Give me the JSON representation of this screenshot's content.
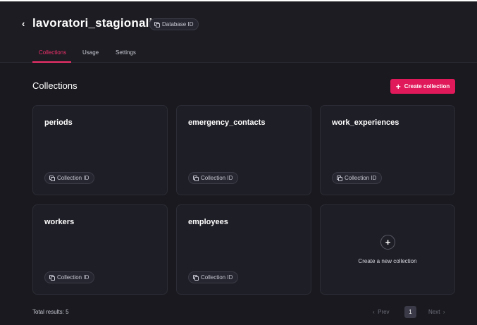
{
  "header": {
    "back_icon": "chevron-left-icon",
    "title": "lavoratori_stagionali",
    "db_id_label": "Database ID"
  },
  "tabs": [
    {
      "label": "Collections",
      "active": true
    },
    {
      "label": "Usage",
      "active": false
    },
    {
      "label": "Settings",
      "active": false
    }
  ],
  "section": {
    "title": "Collections",
    "create_label": "Create collection"
  },
  "collections": [
    {
      "name": "periods",
      "id_label": "Collection ID"
    },
    {
      "name": "emergency_contacts",
      "id_label": "Collection ID"
    },
    {
      "name": "work_experiences",
      "id_label": "Collection ID"
    },
    {
      "name": "workers",
      "id_label": "Collection ID"
    },
    {
      "name": "employees",
      "id_label": "Collection ID"
    }
  ],
  "add_card": {
    "label": "Create a new collection"
  },
  "footer": {
    "total": "Total results: 5",
    "prev": "Prev",
    "page": "1",
    "next": "Next"
  },
  "colors": {
    "accent": "#e0195a",
    "background": "#19191f",
    "card": "#1e1e26"
  }
}
